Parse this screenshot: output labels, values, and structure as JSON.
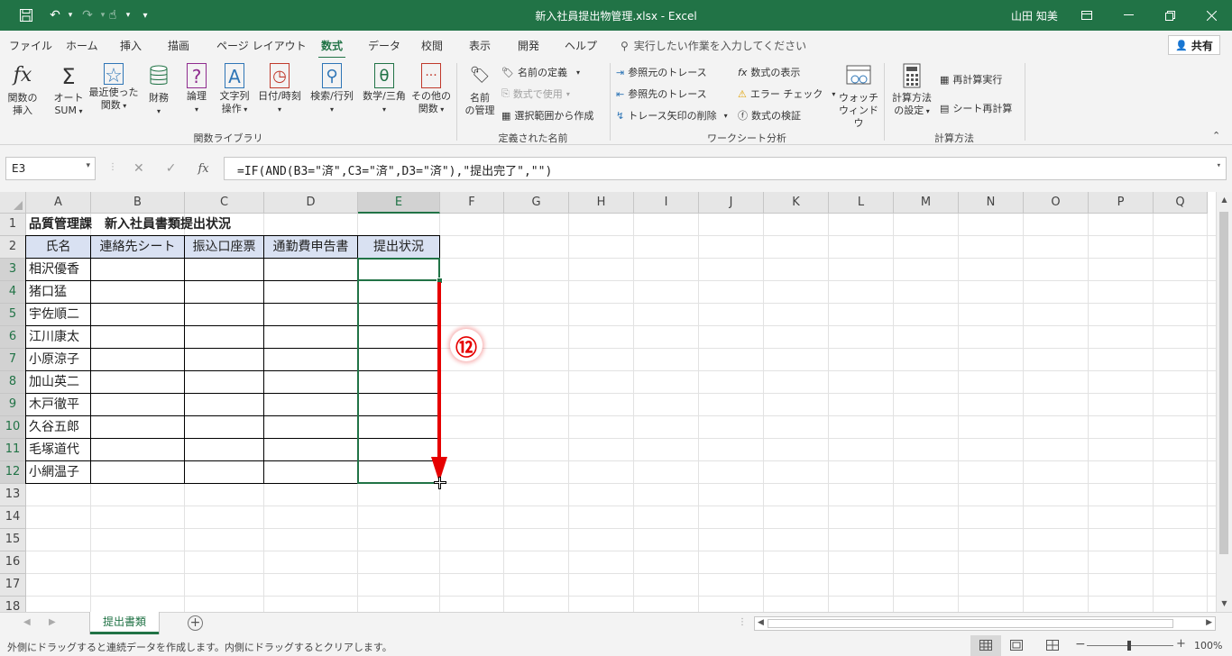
{
  "window": {
    "title": "新入社員提出物管理.xlsx  -  Excel",
    "user": "山田 知美"
  },
  "ribbon_tabs": [
    "ファイル",
    "ホーム",
    "挿入",
    "描画",
    "ページ レイアウト",
    "数式",
    "データ",
    "校閲",
    "表示",
    "開発",
    "ヘルプ"
  ],
  "active_tab": "数式",
  "tell_me": "実行したい作業を入力してください",
  "share": "共有",
  "ribbon": {
    "insert_function": [
      "関数の",
      "挿入"
    ],
    "autosum": [
      "オート",
      "SUM"
    ],
    "recent": [
      "最近使った",
      "関数"
    ],
    "financial": "財務",
    "logical": "論理",
    "text": [
      "文字列",
      "操作"
    ],
    "datetime": "日付/時刻",
    "lookup": "検索/行列",
    "math": "数学/三角",
    "more": [
      "その他の",
      "関数"
    ],
    "name_manager": [
      "名前",
      "の管理"
    ],
    "define_name": "名前の定義",
    "use_in_formula": "数式で使用",
    "create_from_selection": "選択範囲から作成",
    "trace_precedents": "参照元のトレース",
    "trace_dependents": "参照先のトレース",
    "remove_arrows": "トレース矢印の削除",
    "show_formulas": "数式の表示",
    "error_check": "エラー チェック",
    "evaluate": "数式の検証",
    "watch_window": [
      "ウォッチ",
      "ウィンドウ"
    ],
    "calc_options": [
      "計算方法",
      "の設定"
    ],
    "calc_now": "再計算実行",
    "calc_sheet": "シート再計算",
    "groups": [
      "関数ライブラリ",
      "定義された名前",
      "ワークシート分析",
      "計算方法"
    ]
  },
  "formula_bar": {
    "name_box": "E3",
    "formula": "=IF(AND(B3=\"済\",C3=\"済\",D3=\"済\"),\"提出完了\",\"\")"
  },
  "columns": [
    "A",
    "B",
    "C",
    "D",
    "E",
    "F",
    "G",
    "H",
    "I",
    "J",
    "K",
    "L",
    "M",
    "N",
    "O",
    "P",
    "Q"
  ],
  "rows": [
    "1",
    "2",
    "3",
    "4",
    "5",
    "6",
    "7",
    "8",
    "9",
    "10",
    "11",
    "12",
    "13",
    "14",
    "15",
    "16",
    "17",
    "18"
  ],
  "sheet": {
    "title": "品質管理課　新入社員書類提出状況",
    "headers": [
      "氏名",
      "連絡先シート",
      "振込口座票",
      "通勤費申告書",
      "提出状況"
    ],
    "names": [
      "相沢優香",
      "猪口猛",
      "宇佐順二",
      "江川康太",
      "小原涼子",
      "加山英二",
      "木戸徹平",
      "久谷五郎",
      "毛塚道代",
      "小網温子"
    ]
  },
  "annotation": "⑫",
  "sheet_tab": "提出書類",
  "status_text": "外側にドラッグすると連続データを作成します。内側にドラッグするとクリアします。",
  "zoom": "100%",
  "colors": {
    "accent": "#217346",
    "header_fill": "#d9e1f2",
    "arrow": "#e60000"
  }
}
